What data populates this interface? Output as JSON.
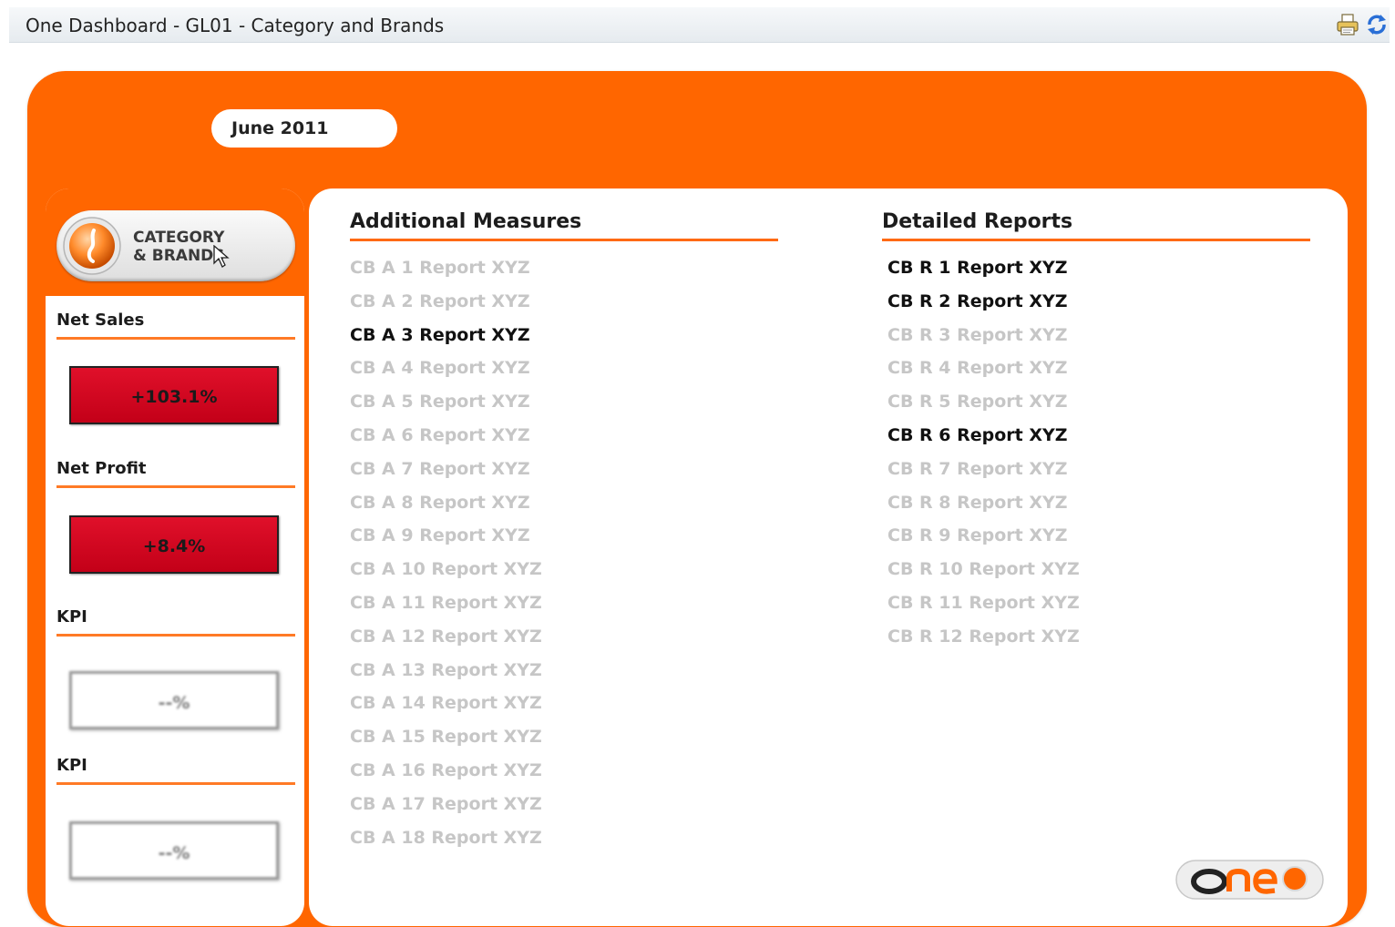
{
  "window": {
    "title": "One Dashboard - GL01 - Category and Brands",
    "icons": [
      "printer-icon",
      "refresh-icon"
    ]
  },
  "header": {
    "date": "June 2011"
  },
  "sidebar": {
    "category_button": {
      "line1": "CATEGORY",
      "line2": "& BRANDS",
      "icon": "category-icon"
    },
    "metrics": [
      {
        "label": "Net Sales",
        "value": "+103.1%",
        "status": "red"
      },
      {
        "label": "Net Profit",
        "value": "+8.4%",
        "status": "red"
      },
      {
        "label": "KPI",
        "value": "--%",
        "status": "none"
      },
      {
        "label": "KPI",
        "value": "--%",
        "status": "none"
      }
    ]
  },
  "additional_measures": {
    "heading": "Additional Measures",
    "items": [
      {
        "label": "CB A 1 Report XYZ",
        "active": false
      },
      {
        "label": "CB A 2 Report XYZ",
        "active": false
      },
      {
        "label": "CB A 3 Report XYZ",
        "active": true
      },
      {
        "label": "CB A 4 Report XYZ",
        "active": false
      },
      {
        "label": "CB A 5 Report XYZ",
        "active": false
      },
      {
        "label": "CB A 6 Report XYZ",
        "active": false
      },
      {
        "label": "CB A 7 Report XYZ",
        "active": false
      },
      {
        "label": "CB A 8 Report XYZ",
        "active": false
      },
      {
        "label": "CB A 9 Report XYZ",
        "active": false
      },
      {
        "label": "CB A 10 Report XYZ",
        "active": false
      },
      {
        "label": "CB A 11 Report XYZ",
        "active": false
      },
      {
        "label": "CB A 12 Report XYZ",
        "active": false
      },
      {
        "label": "CB A 13 Report XYZ",
        "active": false
      },
      {
        "label": "CB A 14 Report XYZ",
        "active": false
      },
      {
        "label": "CB A 15 Report XYZ",
        "active": false
      },
      {
        "label": "CB A 16 Report XYZ",
        "active": false
      },
      {
        "label": "CB A 17 Report XYZ",
        "active": false
      },
      {
        "label": "CB A 18 Report XYZ",
        "active": false
      }
    ]
  },
  "detailed_reports": {
    "heading": "Detailed Reports",
    "items": [
      {
        "label": "CB R 1 Report XYZ",
        "active": true
      },
      {
        "label": "CB R 2 Report XYZ",
        "active": true
      },
      {
        "label": "CB R 3 Report XYZ",
        "active": false
      },
      {
        "label": "CB R 4 Report XYZ",
        "active": false
      },
      {
        "label": "CB R 5 Report XYZ",
        "active": false
      },
      {
        "label": "CB R 6 Report XYZ",
        "active": true
      },
      {
        "label": "CB R 7 Report XYZ",
        "active": false
      },
      {
        "label": "CB R 8 Report XYZ",
        "active": false
      },
      {
        "label": "CB R 9 Report XYZ",
        "active": false
      },
      {
        "label": "CB R 10 Report XYZ",
        "active": false
      },
      {
        "label": "CB R 11 Report XYZ",
        "active": false
      },
      {
        "label": "CB R 12 Report XYZ",
        "active": false
      }
    ]
  },
  "logo": {
    "text": "one",
    "icon": "one-logo"
  },
  "colors": {
    "brand_orange": "#ff6600",
    "status_red": "#d40a22",
    "inactive_text": "#c6c6c6",
    "active_text": "#111111"
  }
}
